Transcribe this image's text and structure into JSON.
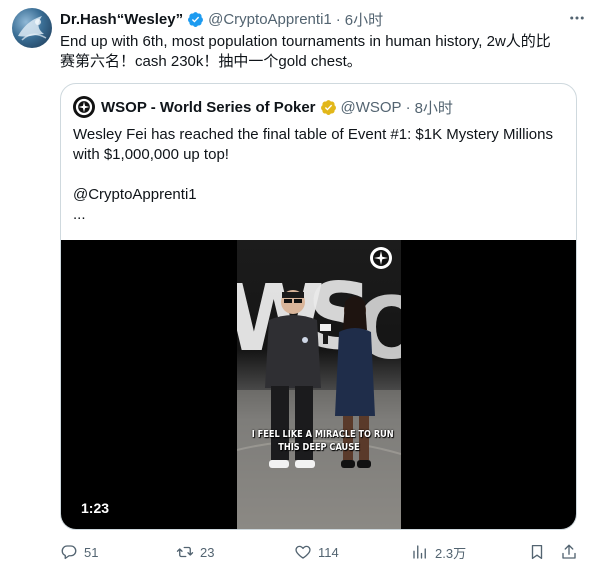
{
  "tweet": {
    "display_name": "Dr.Hash“Wesley”",
    "handle": "@CryptoApprenti1",
    "separator": "·",
    "time": "6小时",
    "text_line1": "End up with 6th, most population tournaments in human history, 2w人的比",
    "text_line2": "赛第六名！cash 230k！抽中一个gold chest。",
    "verified_color": "#1d9bf0"
  },
  "quote": {
    "display_name": "WSOP - World Series of Poker",
    "handle": "@WSOP",
    "separator": "·",
    "time": "8小时",
    "verified_color": "#e2b719",
    "text_line1": "Wesley Fei has reached the final table of Event #1: $1K Mystery Millions",
    "text_line2": "with $1,000,000 up top!",
    "mention": "@CryptoApprenti1",
    "ellipsis": "...",
    "video": {
      "duration": "1:23",
      "caption_line1": "I FEEL LIKE A MIRACLE TO RUN",
      "caption_line2": "THIS DEEP CAUSE",
      "watermark_icon": "wsop-logo-icon"
    }
  },
  "actions": {
    "replies": "51",
    "retweets": "23",
    "likes": "114",
    "views": "2.3万",
    "icons": [
      "reply-icon",
      "retweet-icon",
      "like-icon",
      "views-icon",
      "bookmark-icon",
      "share-icon"
    ]
  },
  "colors": {
    "text": "#0f1419",
    "secondary": "#536471",
    "border": "#cfd9de"
  }
}
